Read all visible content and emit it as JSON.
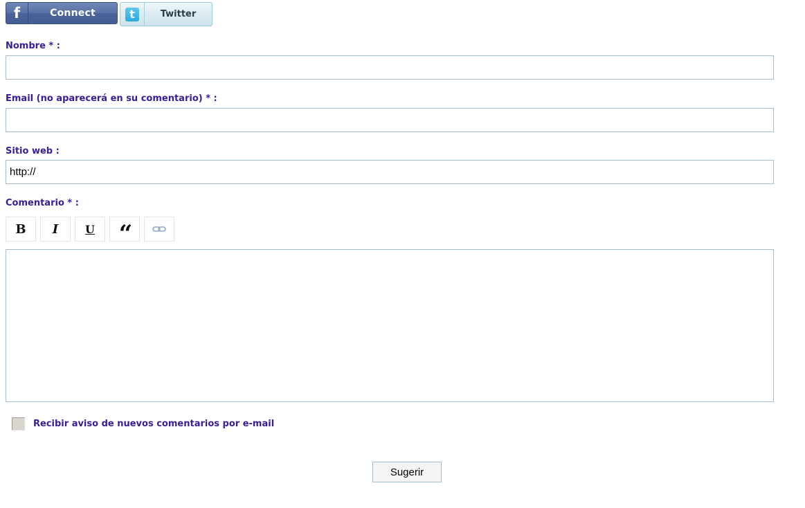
{
  "social": {
    "facebook": {
      "icon": "facebook-f-icon",
      "glyph": "f",
      "label": "Connect"
    },
    "twitter": {
      "icon": "twitter-t-icon",
      "glyph": "t",
      "label": "Twitter"
    }
  },
  "form": {
    "name": {
      "label": "Nombre * :",
      "value": ""
    },
    "email": {
      "label": "Email (no aparecerá en su comentario) * :",
      "value": ""
    },
    "website": {
      "label": "Sitio web :",
      "value": "http://"
    },
    "comment": {
      "label": "Comentario * :",
      "value": "",
      "toolbar": [
        {
          "icon": "bold-icon",
          "glyph": "B"
        },
        {
          "icon": "italic-icon",
          "glyph": "I"
        },
        {
          "icon": "underline-icon",
          "glyph": "U"
        },
        {
          "icon": "quote-icon",
          "glyph": "“"
        },
        {
          "icon": "link-icon"
        }
      ]
    },
    "notify": {
      "label": "Recibir aviso de nuevos comentarios por e-mail",
      "checked": false
    },
    "submit_label": "Sugerir"
  },
  "colors": {
    "label": "#3a1b98",
    "input_border": "#a8bccc",
    "facebook": "#4a6298",
    "twitter_bg": "#dcecf2"
  }
}
